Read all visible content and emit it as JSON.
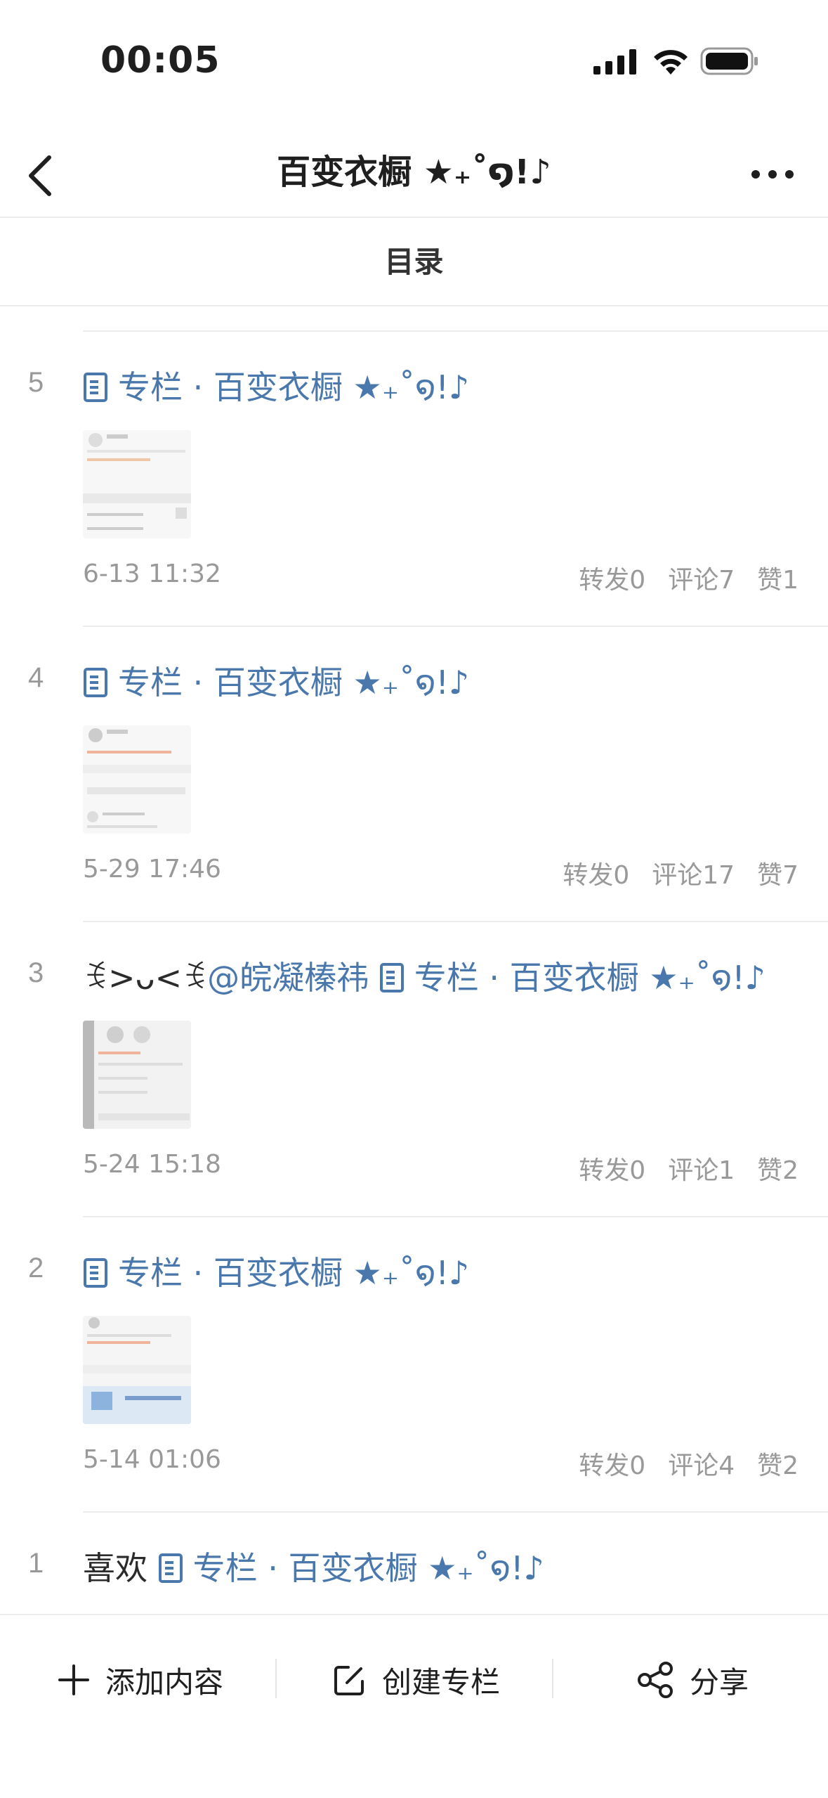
{
  "status_bar": {
    "time": "00:05"
  },
  "nav": {
    "title": "百变衣橱 ★₊˚໑!♪"
  },
  "toc": {
    "header": "目录"
  },
  "items": [
    {
      "number": "5",
      "prefix": "",
      "column_label": "专栏 · 百变衣橱 ★₊˚໑!♪",
      "date": "6-13 11:32",
      "repost": "转发0",
      "comment": "评论7",
      "like": "赞1"
    },
    {
      "number": "4",
      "prefix": "",
      "column_label": "专栏 · 百变衣橱 ★₊˚໑!♪",
      "date": "5-29 17:46",
      "repost": "转发0",
      "comment": "评论17",
      "like": "赞7"
    },
    {
      "number": "3",
      "prefix": "ꉂ>ᴗ<ꉂ",
      "mention": "@皖凝榛祎",
      "column_label": "专栏 · 百变衣橱 ★₊˚໑!♪",
      "date": "5-24 15:18",
      "repost": "转发0",
      "comment": "评论1",
      "like": "赞2"
    },
    {
      "number": "2",
      "prefix": "",
      "column_label": "专栏 · 百变衣橱 ★₊˚໑!♪",
      "date": "5-14 01:06",
      "repost": "转发0",
      "comment": "评论4",
      "like": "赞2"
    },
    {
      "number": "1",
      "prefix": "喜欢",
      "column_label": "专栏 · 百变衣橱 ★₊˚໑!♪"
    }
  ],
  "bottom_bar": {
    "add_label": "添加内容",
    "create_label": "创建专栏",
    "share_label": "分享"
  },
  "icons": [
    "signal-icon",
    "wifi-icon",
    "battery-icon",
    "back-arrow-icon",
    "more-dots-icon",
    "document-icon",
    "plus-icon",
    "edit-icon",
    "share-icon"
  ],
  "colors": {
    "link": "#4a78ad",
    "meta": "#999999"
  }
}
